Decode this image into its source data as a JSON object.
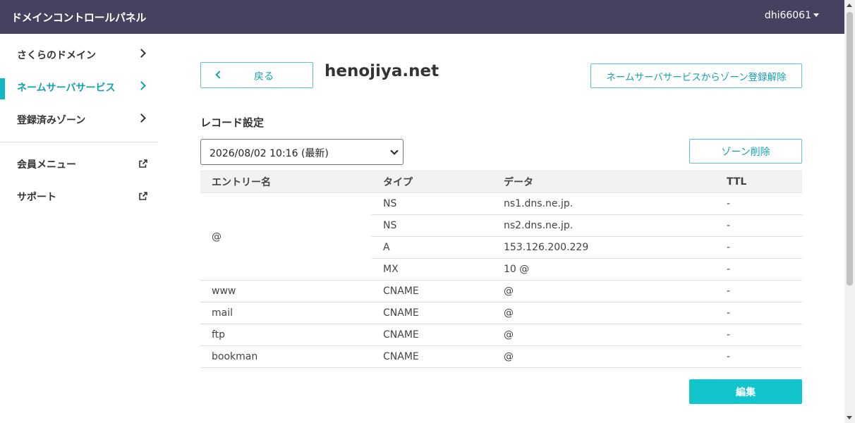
{
  "header": {
    "app_title": "ドメインコントロールパネル",
    "user": "dhi66061"
  },
  "sidebar": {
    "items": [
      {
        "label": "さくらのドメイン",
        "active": false
      },
      {
        "label": "ネームサーバサービス",
        "active": true
      },
      {
        "label": "登録済みゾーン",
        "active": false
      }
    ],
    "external": [
      {
        "label": "会員メニュー"
      },
      {
        "label": "サポート"
      }
    ]
  },
  "main": {
    "back_label": "戻る",
    "domain": "henojiya.net",
    "unregister_label": "ネームサーバサービスからゾーン登録解除",
    "section_title": "レコード設定",
    "version_selected": "2026/08/02 10:16 (最新)",
    "delete_zone_label": "ゾーン削除",
    "table": {
      "headers": [
        "エントリー名",
        "タイプ",
        "データ",
        "TTL"
      ],
      "rows": [
        {
          "entry": "@",
          "type": "NS",
          "data": "ns1.dns.ne.jp.",
          "ttl": "-"
        },
        {
          "entry": "",
          "type": "NS",
          "data": "ns2.dns.ne.jp.",
          "ttl": "-"
        },
        {
          "entry": "",
          "type": "A",
          "data": "153.126.200.229",
          "ttl": "-"
        },
        {
          "entry": "",
          "type": "MX",
          "data": "10 @",
          "ttl": "-"
        },
        {
          "entry": "www",
          "type": "CNAME",
          "data": "@",
          "ttl": "-"
        },
        {
          "entry": "mail",
          "type": "CNAME",
          "data": "@",
          "ttl": "-"
        },
        {
          "entry": "ftp",
          "type": "CNAME",
          "data": "@",
          "ttl": "-"
        },
        {
          "entry": "bookman",
          "type": "CNAME",
          "data": "@",
          "ttl": "-"
        }
      ]
    },
    "edit_label": "編集"
  },
  "colors": {
    "header_bg": "#454260",
    "accent": "#12b7c4",
    "primary_button": "#12c4cc"
  }
}
